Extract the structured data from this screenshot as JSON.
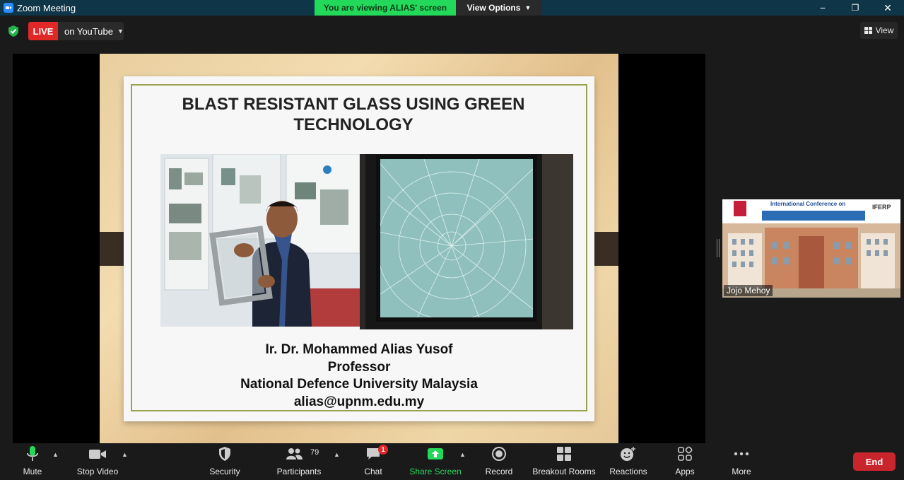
{
  "window": {
    "title": "Zoom Meeting",
    "viewing_banner": "You are viewing ALIAS' screen",
    "view_options": "View Options",
    "minimize_glyph": "−",
    "restore_glyph": "❐",
    "close_glyph": "✕"
  },
  "topbar": {
    "live_label": "LIVE",
    "live_target": "on YouTube",
    "view_label": "View"
  },
  "slide": {
    "title_line1": "BLAST RESISTANT GLASS USING GREEN",
    "title_line2": "TECHNOLOGY",
    "presenter": {
      "name": "Ir. Dr. Mohammed Alias Yusof",
      "position": "Professor",
      "institution": "National Defence University Malaysia",
      "email": "alias@upnm.edu.my"
    }
  },
  "participant_thumb": {
    "name": "Jojo Mehoy",
    "poster_heading": "International Conference on",
    "poster_logo": "IFERP"
  },
  "toolbar": {
    "mute": "Mute",
    "stop_video": "Stop Video",
    "security": "Security",
    "participants": "Participants",
    "participants_count": "79",
    "chat": "Chat",
    "chat_badge": "1",
    "share_screen": "Share Screen",
    "record": "Record",
    "breakout_rooms": "Breakout Rooms",
    "reactions": "Reactions",
    "apps": "Apps",
    "more": "More",
    "end": "End"
  },
  "colors": {
    "titlebar": "#0e3648",
    "banner_green": "#23d959",
    "live_red": "#e02828",
    "end_red": "#c9252d",
    "share_green": "#23d959",
    "slide_frame": "#9aa24f"
  },
  "icons": [
    "zoom-logo-icon",
    "shield-check-icon",
    "grid-view-icon",
    "microphone-icon",
    "video-camera-icon",
    "security-shield-icon",
    "participants-icon",
    "chat-bubble-icon",
    "share-screen-icon",
    "record-icon",
    "breakout-rooms-icon",
    "reactions-icon",
    "apps-icon",
    "more-icon"
  ]
}
